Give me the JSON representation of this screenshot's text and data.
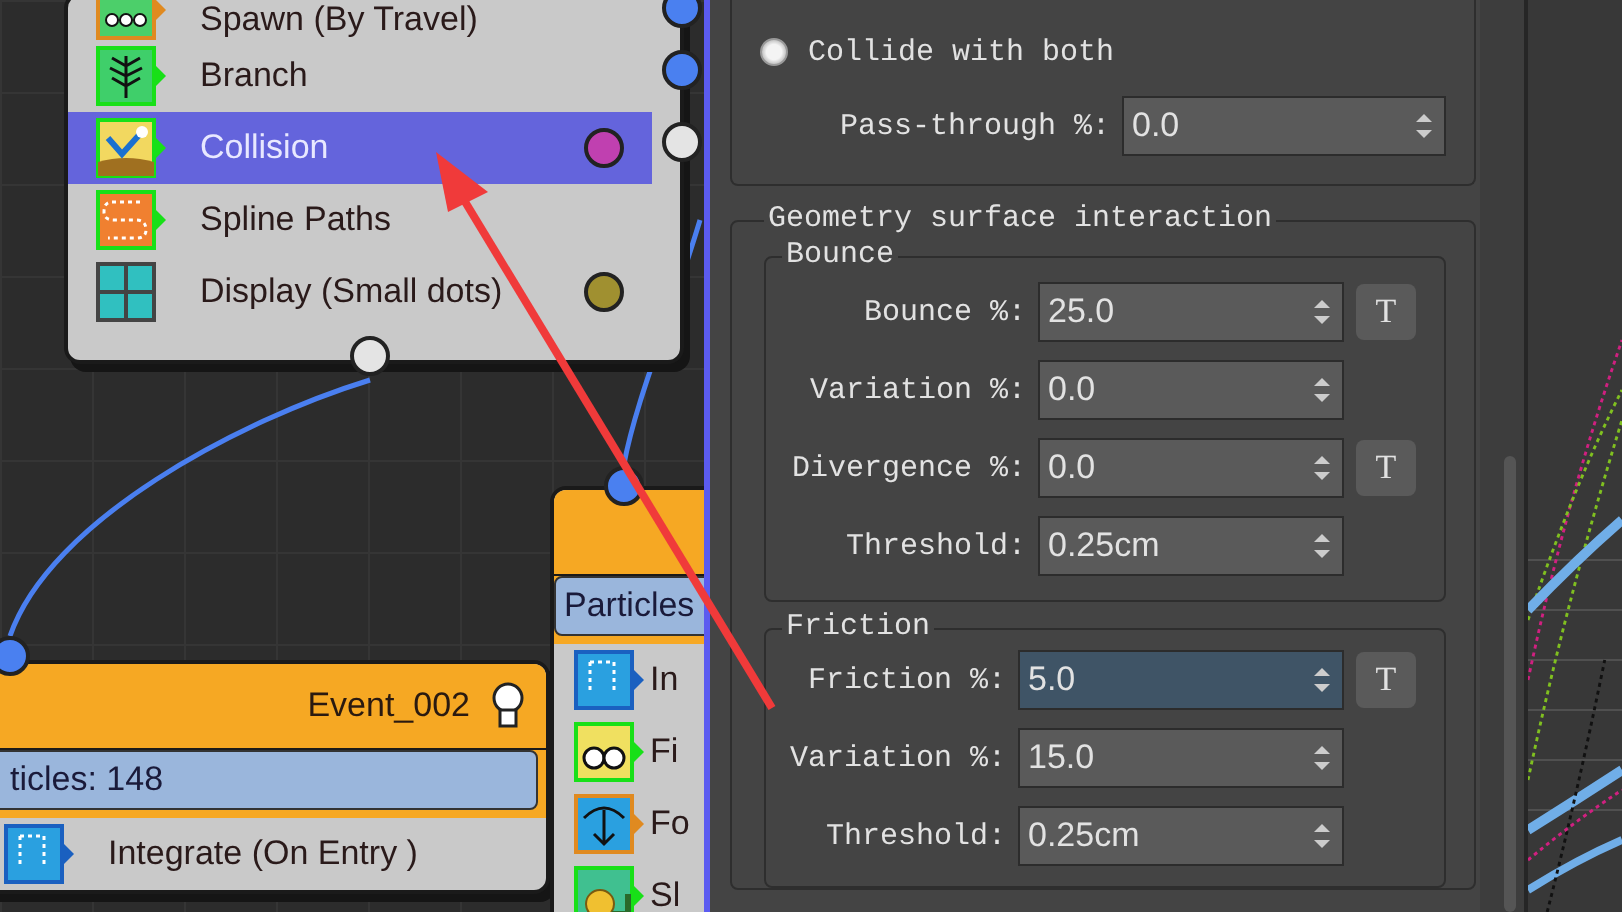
{
  "flow_canvas": {
    "nodes": [
      {
        "kind": "operator_list",
        "items": [
          {
            "label": "Spawn (By Travel)",
            "kind": "spawn",
            "selected": false
          },
          {
            "label": "Branch",
            "kind": "branch",
            "selected": false
          },
          {
            "label": "Collision",
            "kind": "collision",
            "selected": true,
            "color": "#c040b0"
          },
          {
            "label": "Spline Paths",
            "kind": "spline",
            "selected": false
          },
          {
            "label": "Display (Small dots)",
            "kind": "display",
            "selected": false,
            "color": "#a09030"
          }
        ]
      },
      {
        "kind": "event",
        "title": "Event_002",
        "count": "ticles: 148",
        "items": [
          {
            "label": "Integrate (On Entry )",
            "kind": "integrate"
          }
        ]
      },
      {
        "kind": "event",
        "count": "Particles",
        "items": [
          {
            "label": "In",
            "kind": "integrate"
          },
          {
            "label": "Fi",
            "kind": "find"
          },
          {
            "label": "Fo",
            "kind": "force"
          },
          {
            "label": "Sl",
            "kind": "speed"
          }
        ]
      }
    ]
  },
  "collision_settings": {
    "collide_option": {
      "label": "Collide with both",
      "selected": true
    },
    "pass_through": {
      "label": "Pass-through %:",
      "value": "0.0"
    },
    "group": {
      "title": "Geometry surface interaction",
      "subgroups": [
        {
          "title": "Bounce",
          "rows": [
            {
              "label": "Bounce %:",
              "value": "25.0",
              "t_button": "T",
              "focused": false
            },
            {
              "label": "Variation %:",
              "value": "0.0",
              "focused": false
            },
            {
              "label": "Divergence %:",
              "value": "0.0",
              "t_button": "T",
              "focused": false
            },
            {
              "label": "Threshold:",
              "value": "0.25cm",
              "focused": false
            }
          ]
        },
        {
          "title": "Friction",
          "rows": [
            {
              "label": "Friction %:",
              "value": "5.0",
              "t_button": "T",
              "focused": true
            },
            {
              "label": "Variation %:",
              "value": "15.0",
              "focused": false
            },
            {
              "label": "Threshold:",
              "value": "0.25cm",
              "focused": false
            }
          ]
        }
      ]
    }
  }
}
